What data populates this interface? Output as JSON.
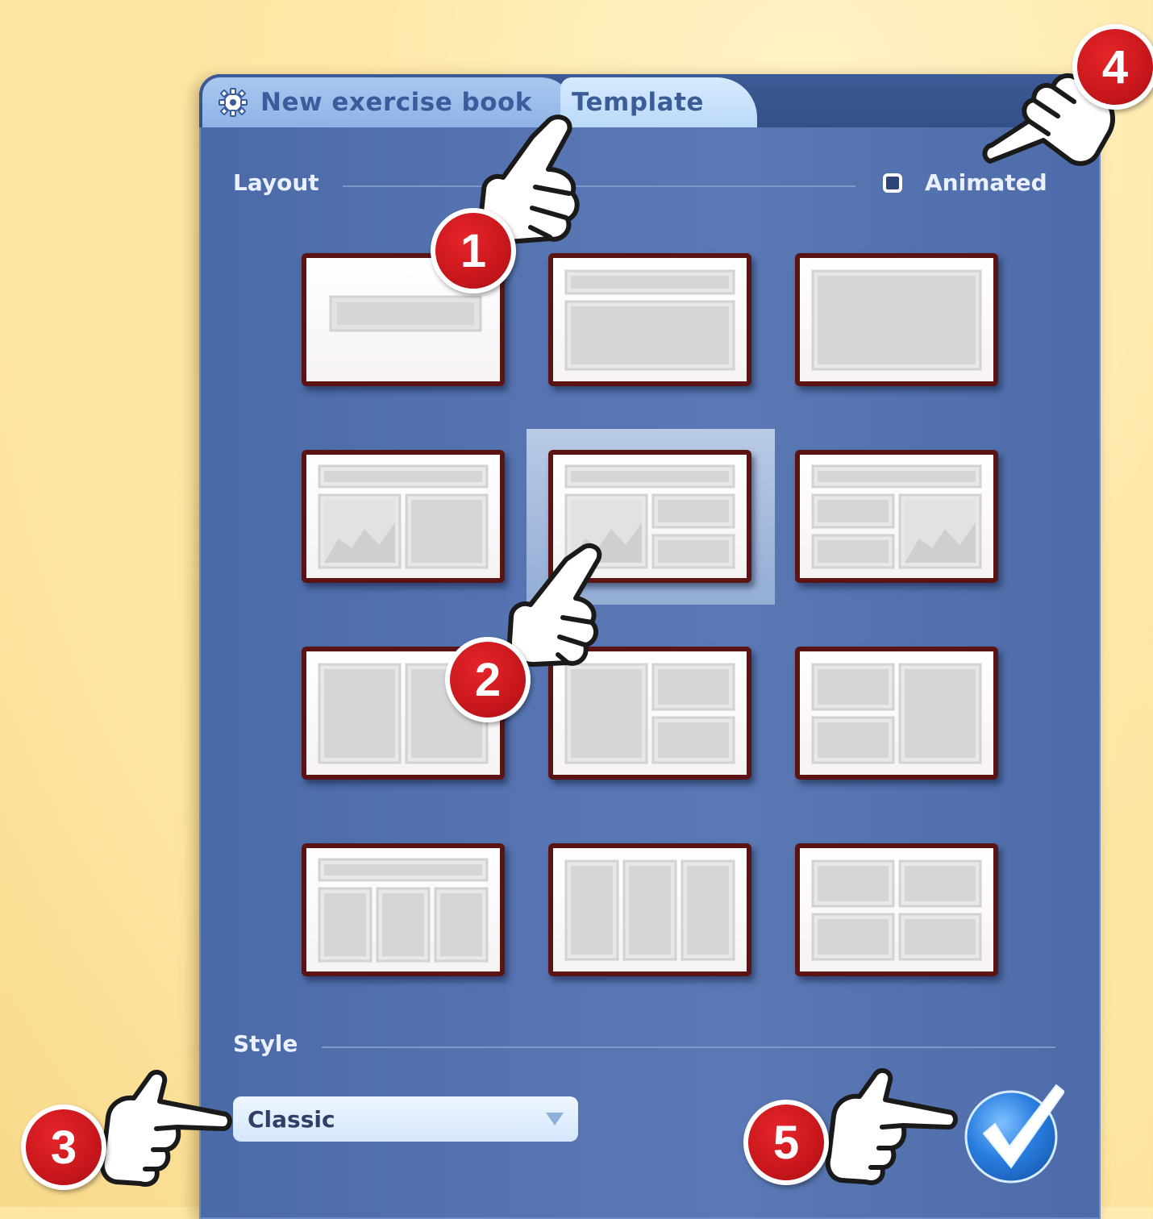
{
  "tabs": [
    {
      "label": "New exercise book",
      "icon": "gear-icon",
      "active": false
    },
    {
      "label": "Template",
      "active": true
    }
  ],
  "layout_section": {
    "label": "Layout"
  },
  "animated_option": {
    "label": "Animated",
    "checked": false
  },
  "templates": [
    {
      "name": "title-only",
      "selected": false
    },
    {
      "name": "title-content",
      "selected": false
    },
    {
      "name": "content-only",
      "selected": false
    },
    {
      "name": "title-image-content",
      "selected": false
    },
    {
      "name": "title-image-two-blocks",
      "selected": true
    },
    {
      "name": "title-two-blocks-image",
      "selected": false
    },
    {
      "name": "two-columns",
      "selected": false
    },
    {
      "name": "column-two-blocks",
      "selected": false
    },
    {
      "name": "two-blocks-column",
      "selected": false
    },
    {
      "name": "title-three-columns",
      "selected": false
    },
    {
      "name": "three-columns",
      "selected": false
    },
    {
      "name": "four-blocks",
      "selected": false
    }
  ],
  "style_section": {
    "label": "Style"
  },
  "style_select": {
    "value": "Classic"
  },
  "confirm": {
    "icon": "checkmark-icon",
    "color": "#2a7fe0"
  },
  "callouts": [
    "1",
    "2",
    "3",
    "4",
    "5"
  ],
  "colors": {
    "dialog_bg": "#5775b2",
    "callout_red": "#c8171c",
    "template_border": "#5a1414",
    "tab_active": "#cfe5ff"
  }
}
